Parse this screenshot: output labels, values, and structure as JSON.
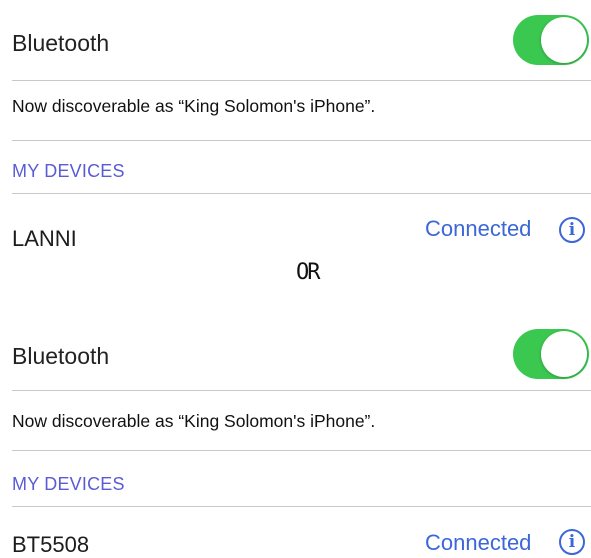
{
  "screens": [
    {
      "bluetooth_label": "Bluetooth",
      "bluetooth_enabled": true,
      "discoverable_text": "Now discoverable as “King Solomon's iPhone”.",
      "section_header": "MY DEVICES",
      "device": {
        "name": "LANNI",
        "status": "Connected"
      },
      "info_icon": "info-circle-icon"
    },
    {
      "bluetooth_label": "Bluetooth",
      "bluetooth_enabled": true,
      "discoverable_text": "Now discoverable as “King Solomon's iPhone”.",
      "section_header": "MY DEVICES",
      "device": {
        "name": "BT5508",
        "status": "Connected"
      },
      "info_icon": "info-circle-icon"
    }
  ],
  "separator_text": "OR",
  "colors": {
    "toggle_on": "#3bc850",
    "link_blue": "#3b67d8",
    "section_header": "#5b5bd6"
  }
}
